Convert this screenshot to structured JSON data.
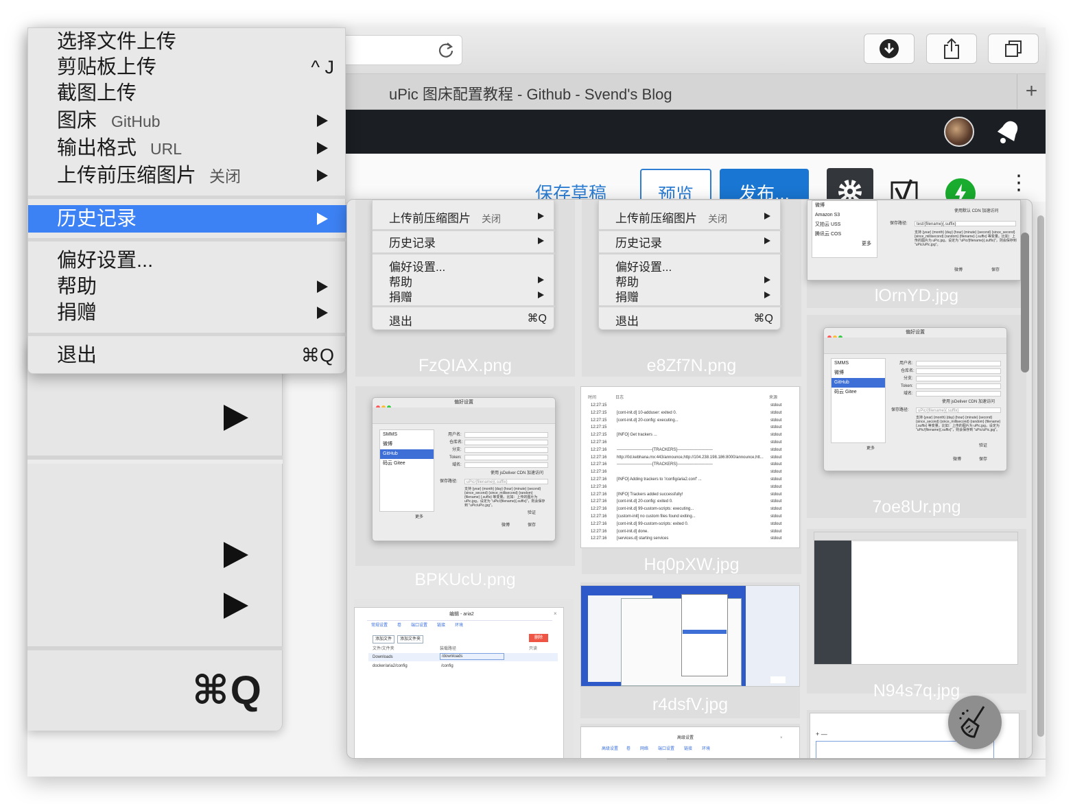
{
  "browser": {
    "tab_title": "uPic 图床配置教程 - Github - Svend's Blog",
    "new_tab": "+"
  },
  "editor": {
    "save_draft": "保存草稿",
    "preview": "预览",
    "publish": "发布...",
    "advanced": "高级"
  },
  "menu": {
    "items": [
      {
        "label": "选择文件上传"
      },
      {
        "label": "剪贴板上传",
        "shortcut": "^ J"
      },
      {
        "label": "截图上传"
      },
      {
        "label": "图床",
        "value": "GitHub"
      },
      {
        "label": "输出格式",
        "value": "URL"
      },
      {
        "label": "上传前压缩图片",
        "value": "关闭"
      },
      {
        "label": "历史记录"
      },
      {
        "label": "偏好设置..."
      },
      {
        "label": "帮助"
      },
      {
        "label": "捐赠"
      },
      {
        "label": "退出",
        "shortcut": "⌘Q"
      }
    ]
  },
  "under_menu": {
    "quit_shortcut": "⌘Q"
  },
  "history": {
    "files": [
      "FzQIAX.png",
      "e8Zf7N.png",
      "lOrnYD.jpg",
      "BPKUcU.png",
      "Hq0pXW.jpg",
      "7oe8Ur.png",
      "r4dsfV.jpg",
      "N94s7q.jpg"
    ],
    "mini_menu": {
      "compress": "上传前压缩图片",
      "compress_value": "关闭",
      "history": "历史记录",
      "prefs": "偏好设置...",
      "help": "帮助",
      "donate": "捐赠",
      "quit": "退出",
      "quit_shortcut": "⌘Q"
    },
    "pref_window": {
      "title": "偏好设置",
      "services": [
        "SMMS",
        "微博",
        "GitHub",
        "码云 Gitee"
      ],
      "services_top": [
        "微博",
        "Amazon S3",
        "又拍云 USS",
        "腾讯云 COS"
      ],
      "more": "更多",
      "use_cdn": "使用 jsDeliver CDN 加速访问",
      "use_default_cdn": "使用默认 CDN 加速访问",
      "username": "用户名:",
      "repo": "仓库名:",
      "branch": "分支:",
      "token": "Token:",
      "domain": "域名:",
      "save_path": "保存路径:",
      "path_value": "uPic/{filename}{.suffix}",
      "path_value_top": "test/{filename}{.suffix}",
      "verify": "验证",
      "save": "保存",
      "weibo_btn": "微博",
      "help_text": "支持 {year} {month} {day} {hour} {minute} {second} {since_second} {since_millisecond} {random} {filename} {.suffix} 等变量。比如：上传的图片为 uPic.jpg，设定为 \"uPic/{filename}{.suffix}\"，则会保存到 \"uPic/uPic.jpg\"。"
    },
    "log": {
      "col_time": "时间",
      "col_log": "日志",
      "col_src": "来源",
      "rows": [
        {
          "t": "12:27:15",
          "m": "",
          "s": "stdout"
        },
        {
          "t": "12:27:15",
          "m": "[cont-init.d] 10-adduser: exited 0.",
          "s": "stdout"
        },
        {
          "t": "12:27:15",
          "m": "[cont-init.d] 20-config: executing...",
          "s": "stdout"
        },
        {
          "t": "12:27:15",
          "m": "",
          "s": "stdout"
        },
        {
          "t": "12:27:15",
          "m": "[INFO] Get trackers ...",
          "s": "stdout"
        },
        {
          "t": "12:27:16",
          "m": "",
          "s": "stdout"
        },
        {
          "t": "12:27:16",
          "m": "--------------------------[TRACKERS]--------------------------",
          "s": "stdout"
        },
        {
          "t": "12:27:16",
          "m": "http://0d.kebhana.mx:443/announce,http://104.238.198.186:8000/announce,htt...",
          "s": "stdout"
        },
        {
          "t": "12:27:16",
          "m": "--------------------------[TRACKERS]--------------------------",
          "s": "stdout"
        },
        {
          "t": "12:27:16",
          "m": "",
          "s": "stdout"
        },
        {
          "t": "12:27:16",
          "m": "[INFO] Adding trackers to '/config/aria2.conf' ...",
          "s": "stdout"
        },
        {
          "t": "12:27:16",
          "m": "",
          "s": "stdout"
        },
        {
          "t": "12:27:16",
          "m": "[INFO] Trackers added successfully!",
          "s": "stdout"
        },
        {
          "t": "12:27:16",
          "m": "[cont-init.d] 20-config: exited 0.",
          "s": "stdout"
        },
        {
          "t": "12:27:16",
          "m": "[cont-init.d] 99-custom-scripts: executing...",
          "s": "stdout"
        },
        {
          "t": "12:27:16",
          "m": "[custom-init] no custom files found exiting...",
          "s": "stdout"
        },
        {
          "t": "12:27:16",
          "m": "[cont-init.d] 99-custom-scripts: exited 0.",
          "s": "stdout"
        },
        {
          "t": "12:27:16",
          "m": "[cont-init.d] done.",
          "s": "stdout"
        },
        {
          "t": "12:27:16",
          "m": "[services.d] starting services",
          "s": "stdout"
        }
      ]
    },
    "aria": {
      "title": "编辑 - aria2",
      "tabs": [
        "常规设置",
        "卷",
        "端口设置",
        "链接",
        "环境"
      ],
      "add_file": "添加文件",
      "add_folder": "添加文件夹",
      "delete": "删除",
      "col_file": "文件/文件夹",
      "col_mount": "装载路径",
      "col_ro": "只读",
      "rows": [
        {
          "file": "Downloads",
          "mount": "/downloads"
        },
        {
          "file": "docker/aria2/config",
          "mount": "/config"
        }
      ],
      "title2": "高级设置",
      "tabs2": [
        "高级设置",
        "卷",
        "网络",
        "端口设置",
        "链接",
        "环境"
      ]
    }
  }
}
